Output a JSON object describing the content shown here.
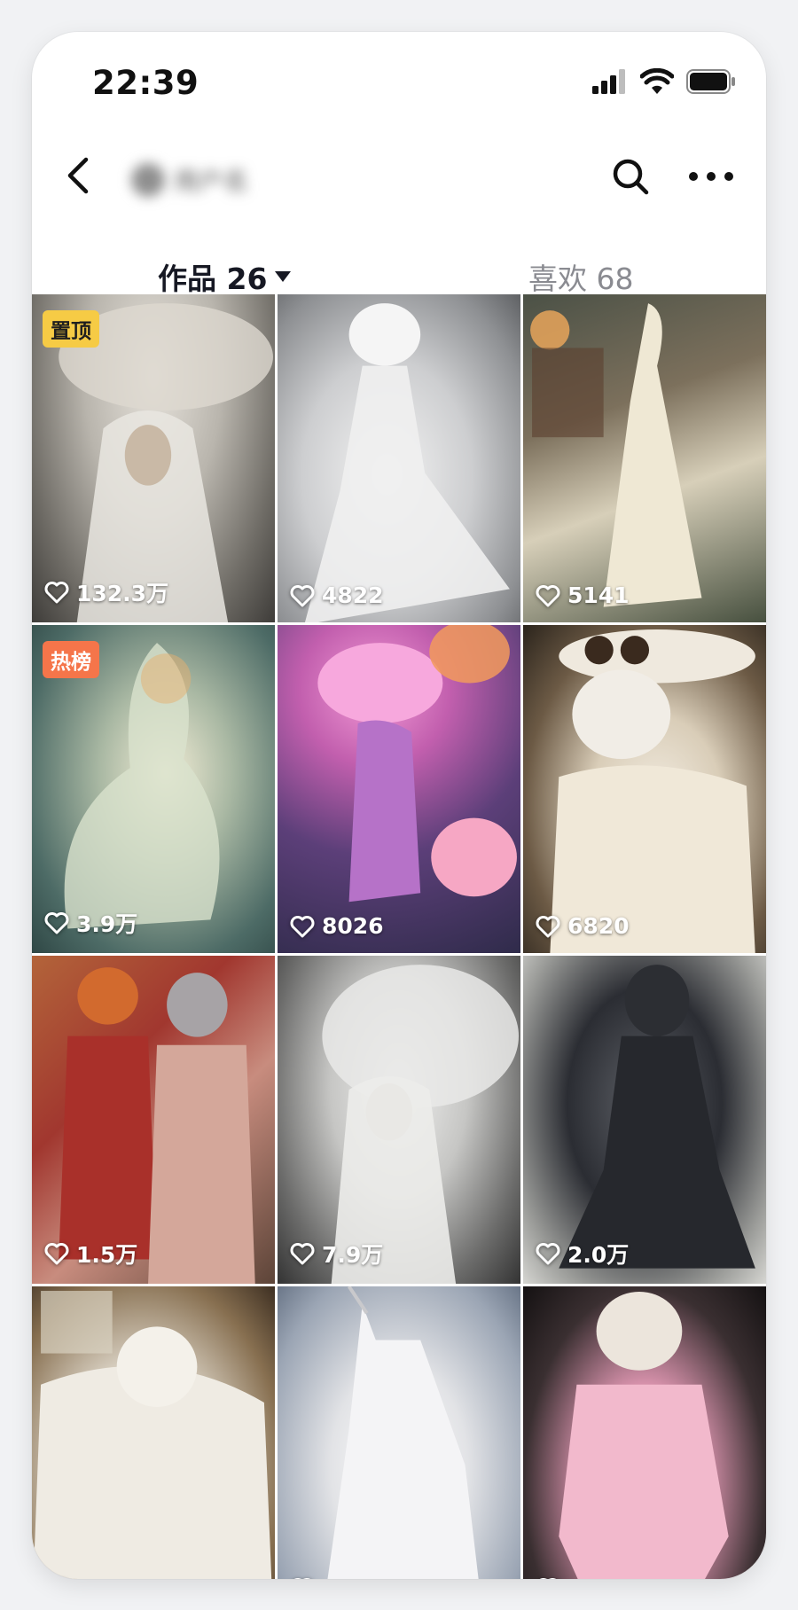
{
  "status": {
    "time": "22:39"
  },
  "header": {
    "title_blurred": "用户名"
  },
  "tabs": {
    "works_label": "作品 26",
    "likes_label": "喜欢 68"
  },
  "grid": [
    {
      "likes": "132.3万",
      "badge": "置顶"
    },
    {
      "likes": "4822"
    },
    {
      "likes": "5141"
    },
    {
      "likes": "3.9万",
      "badge": "热榜"
    },
    {
      "likes": "8026"
    },
    {
      "likes": "6820"
    },
    {
      "likes": "1.5万"
    },
    {
      "likes": "7.9万"
    },
    {
      "likes": "2.0万"
    },
    {
      "likes": ""
    },
    {
      "likes": ""
    },
    {
      "likes": ""
    }
  ],
  "colors": {
    "pin_badge": "#f6cb45",
    "hot_badge": "#f5754a",
    "text_primary": "#161823",
    "text_secondary": "#8a8b91"
  }
}
